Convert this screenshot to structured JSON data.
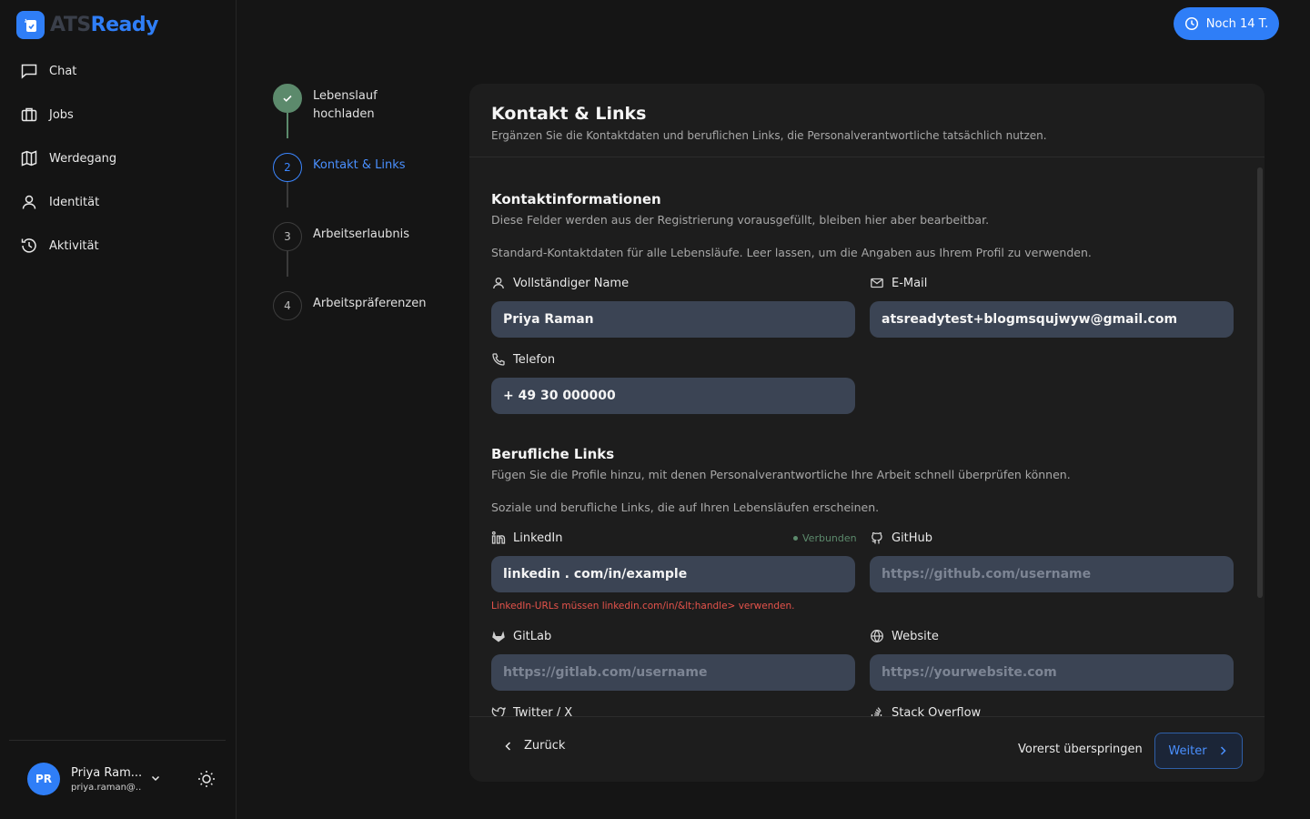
{
  "app": {
    "logo_part1": "ATS",
    "logo_part2": "Ready"
  },
  "sidebar": {
    "items": [
      {
        "label": "Chat",
        "icon": "chat-icon"
      },
      {
        "label": "Jobs",
        "icon": "briefcase-icon"
      },
      {
        "label": "Werdegang",
        "icon": "map-icon"
      },
      {
        "label": "Identität",
        "icon": "user-icon"
      },
      {
        "label": "Aktivität",
        "icon": "history-icon"
      }
    ],
    "user": {
      "initials": "PR",
      "name": "Priya Ram...",
      "email": "priya.raman@..."
    }
  },
  "trial": {
    "label": "Noch 14 T."
  },
  "steps": [
    {
      "number": "",
      "label": "Lebenslauf hochladen",
      "status": "done"
    },
    {
      "number": "2",
      "label": "Kontakt & Links",
      "status": "active"
    },
    {
      "number": "3",
      "label": "Arbeitserlaubnis",
      "status": "pending"
    },
    {
      "number": "4",
      "label": "Arbeitspräferenzen",
      "status": "pending"
    }
  ],
  "card": {
    "title": "Kontakt & Links",
    "subtitle": "Ergänzen Sie die Kontaktdaten und beruflichen Links, die Personalverantwortliche tatsächlich nutzen."
  },
  "contact": {
    "title": "Kontaktinformationen",
    "desc": "Diese Felder werden aus der Registrierung vorausgefüllt, bleiben hier aber bearbeitbar.",
    "note": "Standard-Kontaktdaten für alle Lebensläufe. Leer lassen, um die Angaben aus Ihrem Profil zu verwenden.",
    "name_label": "Vollständiger Name",
    "name_value": "Priya Raman",
    "email_label": "E-Mail",
    "email_value": "atsreadytest+blogmsqujwyw@gmail.com",
    "phone_label": "Telefon",
    "phone_value": "+ 49 30 000000"
  },
  "links": {
    "title": "Berufliche Links",
    "desc": "Fügen Sie die Profile hinzu, mit denen Personalverantwortliche Ihre Arbeit schnell überprüfen können.",
    "note": "Soziale und berufliche Links, die auf Ihren Lebensläufen erscheinen.",
    "linkedin_label": "LinkedIn",
    "linkedin_status": "Verbunden",
    "linkedin_value": "linkedin . com/in/example",
    "linkedin_error": "LinkedIn-URLs müssen linkedin.com/in/&lt;handle> verwenden.",
    "github_label": "GitHub",
    "github_placeholder": "https://github.com/username",
    "gitlab_label": "GitLab",
    "gitlab_placeholder": "https://gitlab.com/username",
    "website_label": "Website",
    "website_placeholder": "https://yourwebsite.com",
    "twitter_label": "Twitter / X",
    "stackoverflow_label": "Stack Overflow"
  },
  "footer": {
    "back": "Zurück",
    "skip": "Vorerst überspringen",
    "next": "Weiter"
  },
  "colors": {
    "accent": "#2f7ef7",
    "success": "#5c8a6c",
    "error": "#e5534b",
    "input_bg": "#3b4454"
  }
}
